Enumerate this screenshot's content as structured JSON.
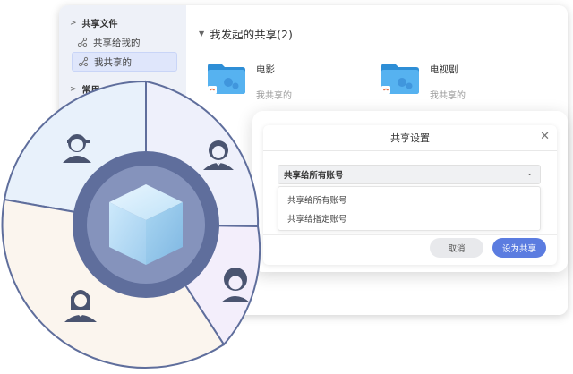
{
  "sidebar": {
    "section_shared": "共享文件",
    "items": [
      {
        "label": "共享给我的"
      },
      {
        "label": "我共享的"
      }
    ],
    "section_common": "常用"
  },
  "main": {
    "title": "我发起的共享(2)",
    "folders": [
      {
        "name": "电影",
        "sub": "我共享的"
      },
      {
        "name": "电视剧",
        "sub": "我共享的"
      }
    ]
  },
  "dialog": {
    "title": "共享设置",
    "close_icon": "close-icon",
    "select_value": "共享给所有账号",
    "options": [
      "共享给所有账号",
      "共享给指定账号"
    ],
    "cancel_label": "取消",
    "confirm_label": "设为共享"
  },
  "colors": {
    "accent": "#5b7ce0",
    "sidebar_bg": "#eef1f8",
    "wheel_ring": "#5f6e9c",
    "folder_blue": "#4ea6e8"
  }
}
